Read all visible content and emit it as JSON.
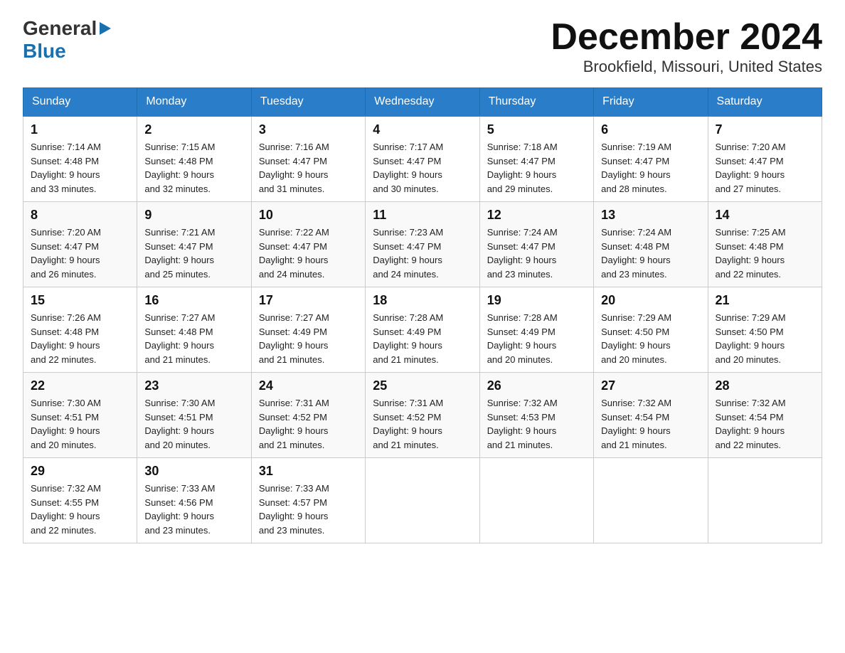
{
  "header": {
    "logo_general": "General",
    "logo_blue": "Blue",
    "title": "December 2024",
    "subtitle": "Brookfield, Missouri, United States"
  },
  "days_of_week": [
    "Sunday",
    "Monday",
    "Tuesday",
    "Wednesday",
    "Thursday",
    "Friday",
    "Saturday"
  ],
  "weeks": [
    [
      {
        "day": "1",
        "sunrise": "7:14 AM",
        "sunset": "4:48 PM",
        "daylight": "9 hours and 33 minutes."
      },
      {
        "day": "2",
        "sunrise": "7:15 AM",
        "sunset": "4:48 PM",
        "daylight": "9 hours and 32 minutes."
      },
      {
        "day": "3",
        "sunrise": "7:16 AM",
        "sunset": "4:47 PM",
        "daylight": "9 hours and 31 minutes."
      },
      {
        "day": "4",
        "sunrise": "7:17 AM",
        "sunset": "4:47 PM",
        "daylight": "9 hours and 30 minutes."
      },
      {
        "day": "5",
        "sunrise": "7:18 AM",
        "sunset": "4:47 PM",
        "daylight": "9 hours and 29 minutes."
      },
      {
        "day": "6",
        "sunrise": "7:19 AM",
        "sunset": "4:47 PM",
        "daylight": "9 hours and 28 minutes."
      },
      {
        "day": "7",
        "sunrise": "7:20 AM",
        "sunset": "4:47 PM",
        "daylight": "9 hours and 27 minutes."
      }
    ],
    [
      {
        "day": "8",
        "sunrise": "7:20 AM",
        "sunset": "4:47 PM",
        "daylight": "9 hours and 26 minutes."
      },
      {
        "day": "9",
        "sunrise": "7:21 AM",
        "sunset": "4:47 PM",
        "daylight": "9 hours and 25 minutes."
      },
      {
        "day": "10",
        "sunrise": "7:22 AM",
        "sunset": "4:47 PM",
        "daylight": "9 hours and 24 minutes."
      },
      {
        "day": "11",
        "sunrise": "7:23 AM",
        "sunset": "4:47 PM",
        "daylight": "9 hours and 24 minutes."
      },
      {
        "day": "12",
        "sunrise": "7:24 AM",
        "sunset": "4:47 PM",
        "daylight": "9 hours and 23 minutes."
      },
      {
        "day": "13",
        "sunrise": "7:24 AM",
        "sunset": "4:48 PM",
        "daylight": "9 hours and 23 minutes."
      },
      {
        "day": "14",
        "sunrise": "7:25 AM",
        "sunset": "4:48 PM",
        "daylight": "9 hours and 22 minutes."
      }
    ],
    [
      {
        "day": "15",
        "sunrise": "7:26 AM",
        "sunset": "4:48 PM",
        "daylight": "9 hours and 22 minutes."
      },
      {
        "day": "16",
        "sunrise": "7:27 AM",
        "sunset": "4:48 PM",
        "daylight": "9 hours and 21 minutes."
      },
      {
        "day": "17",
        "sunrise": "7:27 AM",
        "sunset": "4:49 PM",
        "daylight": "9 hours and 21 minutes."
      },
      {
        "day": "18",
        "sunrise": "7:28 AM",
        "sunset": "4:49 PM",
        "daylight": "9 hours and 21 minutes."
      },
      {
        "day": "19",
        "sunrise": "7:28 AM",
        "sunset": "4:49 PM",
        "daylight": "9 hours and 20 minutes."
      },
      {
        "day": "20",
        "sunrise": "7:29 AM",
        "sunset": "4:50 PM",
        "daylight": "9 hours and 20 minutes."
      },
      {
        "day": "21",
        "sunrise": "7:29 AM",
        "sunset": "4:50 PM",
        "daylight": "9 hours and 20 minutes."
      }
    ],
    [
      {
        "day": "22",
        "sunrise": "7:30 AM",
        "sunset": "4:51 PM",
        "daylight": "9 hours and 20 minutes."
      },
      {
        "day": "23",
        "sunrise": "7:30 AM",
        "sunset": "4:51 PM",
        "daylight": "9 hours and 20 minutes."
      },
      {
        "day": "24",
        "sunrise": "7:31 AM",
        "sunset": "4:52 PM",
        "daylight": "9 hours and 21 minutes."
      },
      {
        "day": "25",
        "sunrise": "7:31 AM",
        "sunset": "4:52 PM",
        "daylight": "9 hours and 21 minutes."
      },
      {
        "day": "26",
        "sunrise": "7:32 AM",
        "sunset": "4:53 PM",
        "daylight": "9 hours and 21 minutes."
      },
      {
        "day": "27",
        "sunrise": "7:32 AM",
        "sunset": "4:54 PM",
        "daylight": "9 hours and 21 minutes."
      },
      {
        "day": "28",
        "sunrise": "7:32 AM",
        "sunset": "4:54 PM",
        "daylight": "9 hours and 22 minutes."
      }
    ],
    [
      {
        "day": "29",
        "sunrise": "7:32 AM",
        "sunset": "4:55 PM",
        "daylight": "9 hours and 22 minutes."
      },
      {
        "day": "30",
        "sunrise": "7:33 AM",
        "sunset": "4:56 PM",
        "daylight": "9 hours and 23 minutes."
      },
      {
        "day": "31",
        "sunrise": "7:33 AM",
        "sunset": "4:57 PM",
        "daylight": "9 hours and 23 minutes."
      },
      null,
      null,
      null,
      null
    ]
  ],
  "labels": {
    "sunrise": "Sunrise:",
    "sunset": "Sunset:",
    "daylight": "Daylight:"
  }
}
